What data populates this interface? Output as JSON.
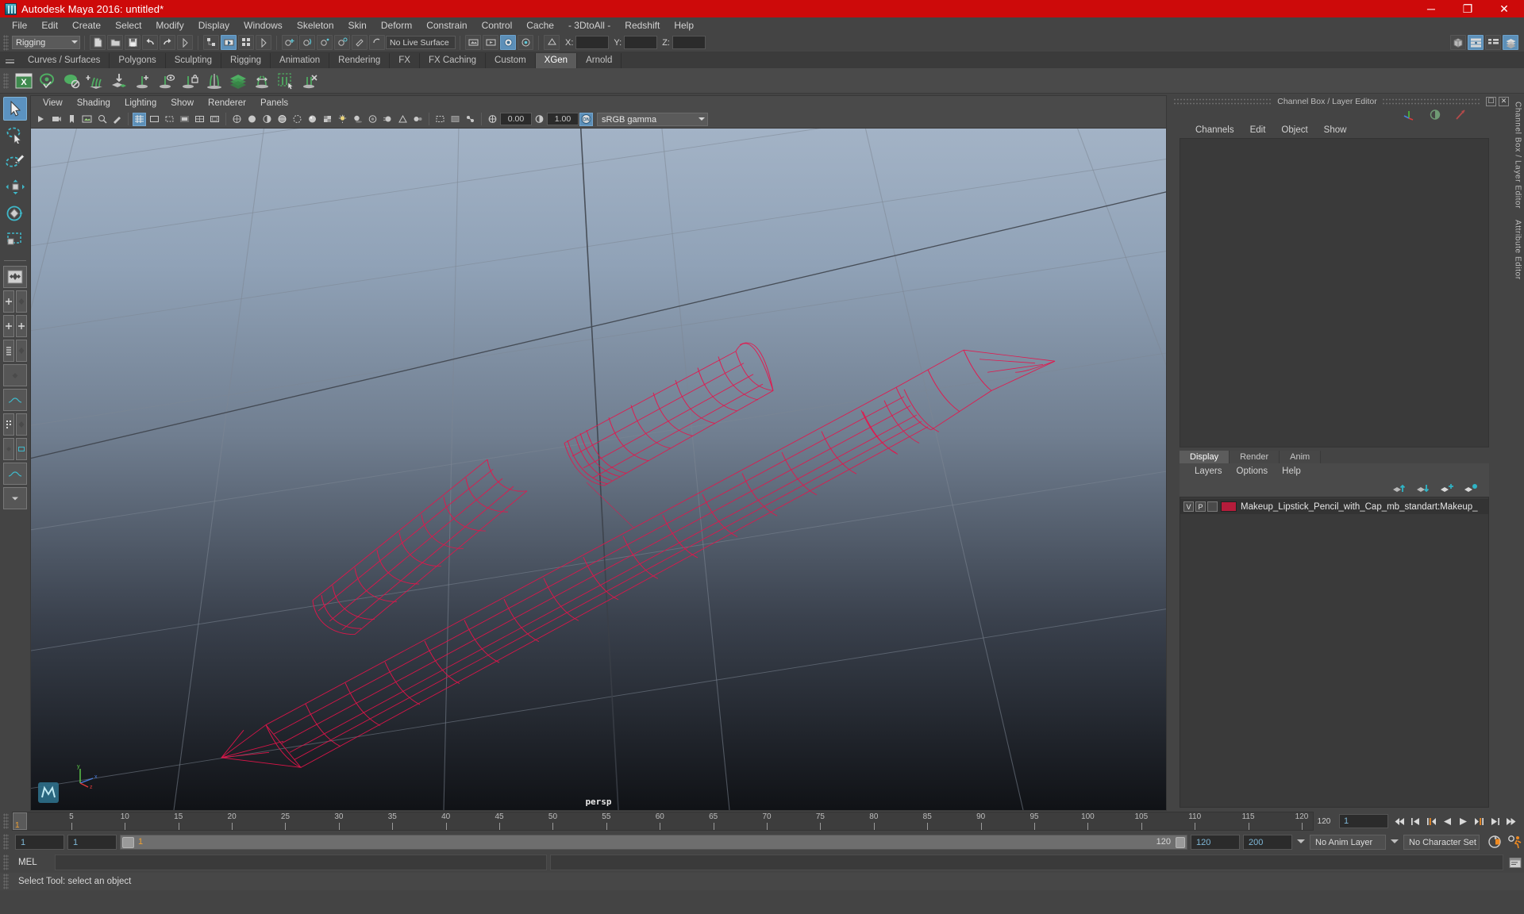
{
  "window": {
    "title": "Autodesk Maya 2016: untitled*",
    "app_icon": "maya-icon",
    "minimize": "─",
    "maximize": "❐",
    "close": "✕",
    "titlebar_color": "#cd0a0a"
  },
  "menubar": {
    "items": [
      "File",
      "Edit",
      "Create",
      "Select",
      "Modify",
      "Display",
      "Windows",
      "Skeleton",
      "Skin",
      "Deform",
      "Constrain",
      "Control",
      "Cache",
      "- 3DtoAll -",
      "Redshift",
      "Help"
    ]
  },
  "statusline": {
    "menu_set": "Rigging",
    "live_surface": "No Live Surface",
    "x_label": "X:",
    "y_label": "Y:",
    "z_label": "Z:",
    "x_value": "",
    "y_value": "",
    "z_value": ""
  },
  "shelf": {
    "tabs": [
      "Curves / Surfaces",
      "Polygons",
      "Sculpting",
      "Rigging",
      "Animation",
      "Rendering",
      "FX",
      "FX Caching",
      "Custom",
      "XGen",
      "Arnold"
    ],
    "active_tab": "XGen",
    "icons": [
      "xgen-editor-icon",
      "preview-visibility-icon",
      "disable-preview-icon",
      "add-groom-icon",
      "place-guides-icon",
      "add-guide-icon",
      "guide-visibility-icon",
      "lock-guide-icon",
      "mirror-guides-icon",
      "density-mask-icon",
      "bend-guides-icon",
      "select-guides-region-icon",
      "clear-guides-icon"
    ]
  },
  "toolbox": {
    "tools": [
      "select-tool",
      "lasso-select-tool",
      "paint-select-tool",
      "move-tool",
      "rotate-tool",
      "scale-tool"
    ],
    "active_tool": "select-tool",
    "layout_presets": [
      "single-pane-layout",
      "four-view-layout",
      "outliner-persp-layout",
      "persp-graph-layout",
      "hypershade-persp-layout",
      "persp-graph-outliner-layout"
    ]
  },
  "viewport": {
    "menus": [
      "View",
      "Shading",
      "Lighting",
      "Show",
      "Renderer",
      "Panels"
    ],
    "camera_label": "persp",
    "exposure_value": "0.00",
    "gamma_value": "1.00",
    "color_management": "sRGB gamma",
    "color_management_enabled": "ON",
    "axis_gizmo": {
      "x": "x",
      "y": "y",
      "z": "z"
    },
    "background_top": "#9fb0c4",
    "background_bottom": "#121418",
    "wireframe_color": "#e6144b",
    "grid_color": "#6a7380"
  },
  "channelbox": {
    "panel_title": "Channel Box / Layer Editor",
    "menus": [
      "Channels",
      "Edit",
      "Object",
      "Show"
    ],
    "restore_icon": "restore-panel-icon",
    "close_icon": "close-panel-icon",
    "toolbar_icons": [
      "move-axis-icon",
      "half-circle-icon",
      "arrow-diagonal-icon"
    ]
  },
  "layereditor": {
    "tabs": [
      "Display",
      "Render",
      "Anim"
    ],
    "active_tab": "Display",
    "menus": [
      "Layers",
      "Options",
      "Help"
    ],
    "tool_icons": [
      "move-layer-up-icon",
      "move-layer-down-icon",
      "new-layer-icon",
      "new-layer-selected-icon"
    ],
    "layers": [
      {
        "visibility": "V",
        "playback": "P",
        "shading": "",
        "color": "#b51c3b",
        "name": "Makeup_Lipstick_Pencil_with_Cap_mb_standart:Makeup_"
      }
    ]
  },
  "right_edge": {
    "vertical_tabs": [
      "Channel Box / Layer Editor",
      "Attribute Editor"
    ]
  },
  "timeline": {
    "start": 1,
    "end": 120,
    "current_frame": "1",
    "tick_labels": [
      5,
      10,
      15,
      20,
      25,
      30,
      35,
      40,
      45,
      50,
      55,
      60,
      65,
      70,
      75,
      80,
      85,
      90,
      95,
      100,
      105,
      110,
      115,
      120
    ],
    "end_label": "120",
    "frame_field": "1",
    "transport_buttons": [
      "go-to-start-icon",
      "step-back-keyframe-icon",
      "step-back-frame-icon",
      "play-backwards-icon",
      "play-forwards-icon",
      "step-forward-frame-icon",
      "step-forward-keyframe-icon",
      "go-to-end-icon"
    ]
  },
  "rangeslider": {
    "anim_start": "1",
    "range_start": "1",
    "slider_start_label": "1",
    "slider_end_label": "120",
    "range_end": "120",
    "anim_end": "200",
    "anim_layer": "No Anim Layer",
    "character_set": "No Character Set",
    "auto_key_icon": "auto-keyframe-icon",
    "anim_prefs_icon": "animation-preferences-icon"
  },
  "commandline": {
    "language_label": "MEL",
    "input_value": "",
    "output_value": ""
  },
  "helpline": {
    "text": "Select Tool: select an object"
  }
}
